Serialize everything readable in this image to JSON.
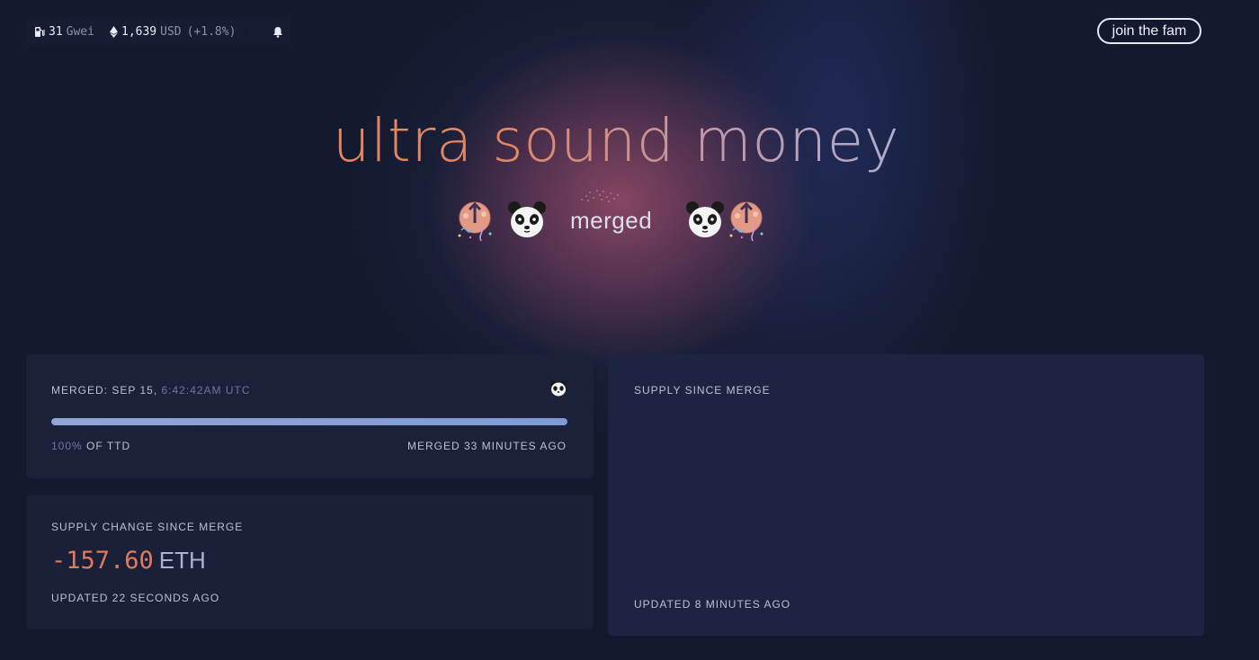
{
  "topbar": {
    "gas_value": "31",
    "gas_unit": "Gwei",
    "eth_price": "1,639",
    "eth_currency": "USD",
    "eth_change": "(+1.8%)",
    "join_label": "join the fam"
  },
  "hero": {
    "title": "ultra sound money",
    "status": "merged"
  },
  "merge_card": {
    "label_prefix": "MERGED: ",
    "label_date": "SEP 15, ",
    "label_time": "6:42:42AM UTC",
    "progress_fraction": 1.0,
    "progress_pct": "100%",
    "progress_suffix": " OF TTD",
    "merged_ago": "MERGED 33 MINUTES AGO"
  },
  "supply_change_card": {
    "label": "SUPPLY CHANGE SINCE MERGE",
    "value": "-157.60",
    "unit": "ETH",
    "updated": "UPDATED 22 SECONDS AGO"
  },
  "supply_since_card": {
    "label": "SUPPLY SINCE MERGE",
    "updated": "UPDATED 8 MINUTES AGO"
  },
  "colors": {
    "background": "#131a2e",
    "accent_orange": "#e07a5f",
    "progress": "#8fa6d6"
  }
}
